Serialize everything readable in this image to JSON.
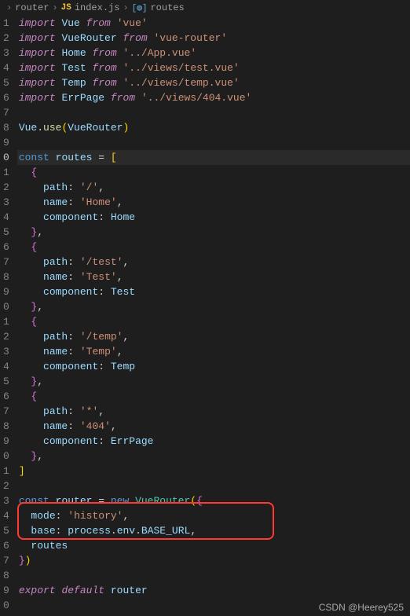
{
  "breadcrumb": {
    "folder": "router",
    "file": "index.js",
    "symbol": "routes"
  },
  "watermark": "CSDN @Heerey525",
  "code": {
    "l1": {
      "a": "import",
      "b": "Vue",
      "c": "from",
      "d": "'vue'"
    },
    "l2": {
      "a": "import",
      "b": "VueRouter",
      "c": "from",
      "d": "'vue-router'"
    },
    "l3": {
      "a": "import",
      "b": "Home",
      "c": "from",
      "d": "'../App.vue'"
    },
    "l4": {
      "a": "import",
      "b": "Test",
      "c": "from",
      "d": "'../views/test.vue'"
    },
    "l5": {
      "a": "import",
      "b": "Temp",
      "c": "from",
      "d": "'../views/temp.vue'"
    },
    "l6": {
      "a": "import",
      "b": "ErrPage",
      "c": "from",
      "d": "'../views/404.vue'"
    },
    "l8": {
      "a": "Vue",
      "b": "use",
      "c": "VueRouter"
    },
    "l10": {
      "a": "const",
      "b": "routes",
      "c": " = "
    },
    "l12": {
      "a": "path",
      "b": "'/'"
    },
    "l13": {
      "a": "name",
      "b": "'Home'"
    },
    "l14": {
      "a": "component",
      "b": "Home"
    },
    "l17": {
      "a": "path",
      "b": "'/test'"
    },
    "l18": {
      "a": "name",
      "b": "'Test'"
    },
    "l19": {
      "a": "component",
      "b": "Test"
    },
    "l22": {
      "a": "path",
      "b": "'/temp'"
    },
    "l23": {
      "a": "name",
      "b": "'Temp'"
    },
    "l24": {
      "a": "component",
      "b": "Temp"
    },
    "l27": {
      "a": "path",
      "b": "'*'"
    },
    "l28": {
      "a": "name",
      "b": "'404'"
    },
    "l29": {
      "a": "component",
      "b": "ErrPage"
    },
    "l33": {
      "a": "const",
      "b": "router",
      "c": " = ",
      "d": "new",
      "e": "VueRouter"
    },
    "l34": {
      "a": "mode",
      "b": "'history'"
    },
    "l35": {
      "a": "base",
      "b": "process",
      "c": "env",
      "d": "BASE_URL"
    },
    "l36": {
      "a": "routes"
    },
    "l39": {
      "a": "export",
      "b": "default",
      "c": "router"
    }
  },
  "gutter": [
    "1",
    "2",
    "3",
    "4",
    "5",
    "6",
    "7",
    "8",
    "9",
    "0",
    "1",
    "2",
    "3",
    "4",
    "5",
    "6",
    "7",
    "8",
    "9",
    "0",
    "1",
    "2",
    "3",
    "4",
    "5",
    "6",
    "7",
    "8",
    "9",
    "0",
    "1",
    "2",
    "3",
    "4",
    "5",
    "6",
    "7",
    "8",
    "9",
    "0"
  ]
}
